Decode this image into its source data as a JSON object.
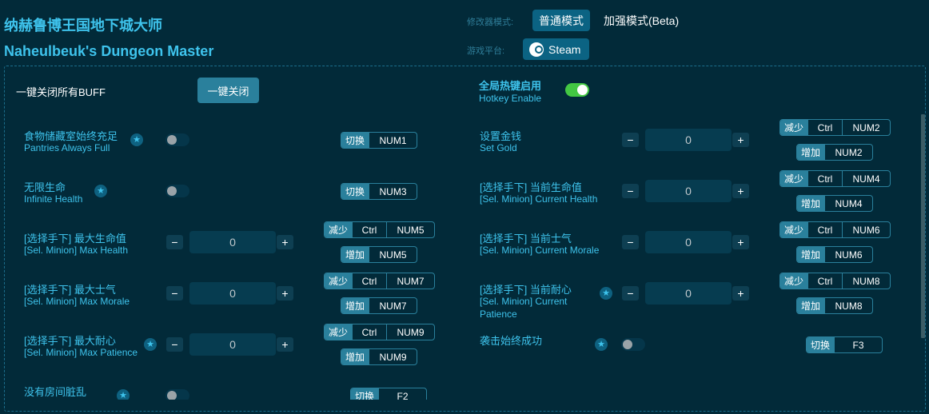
{
  "header": {
    "title_cn": "纳赫鲁博王国地下城大师",
    "title_en": "Naheulbeuk's Dungeon Master",
    "mode_label": "修改器模式:",
    "mode_normal": "普通模式",
    "mode_beta": "加强模式(Beta)",
    "platform_label": "游戏平台:",
    "platform": "Steam"
  },
  "global": {
    "close_all_label": "一键关闭所有BUFF",
    "close_all_button": "一键关闭",
    "hotkey_cn": "全局热键启用",
    "hotkey_en": "Hotkey Enable",
    "hotkey_enabled": true
  },
  "tags": {
    "toggle": "切换",
    "decrease": "减少",
    "increase": "增加",
    "ctrl": "Ctrl"
  },
  "left": [
    {
      "cn": "食物储藏室始终充足",
      "en": "Pantries Always Full",
      "type": "toggle",
      "on": false,
      "key": "NUM1"
    },
    {
      "cn": "无限生命",
      "en": "Infinite Health",
      "type": "toggle",
      "on": false,
      "key": "NUM3"
    },
    {
      "cn": "[选择手下] 最大生命值",
      "en": "[Sel. Minion] Max Health",
      "type": "number",
      "value": "0",
      "dec_key": "NUM5",
      "inc_key": "NUM5"
    },
    {
      "cn": "[选择手下] 最大士气",
      "en": "[Sel. Minion] Max Morale",
      "type": "number",
      "value": "0",
      "dec_key": "NUM7",
      "inc_key": "NUM7"
    },
    {
      "cn": "[选择手下] 最大耐心",
      "en": "[Sel. Minion] Max Patience",
      "type": "number",
      "value": "0",
      "dec_key": "NUM9",
      "inc_key": "NUM9"
    },
    {
      "cn": "没有房间脏乱",
      "en": "",
      "type": "toggle",
      "on": false,
      "key": "F2"
    }
  ],
  "right": [
    {
      "cn": "设置金钱",
      "en": "Set Gold",
      "type": "number",
      "value": "0",
      "dec_key": "NUM2",
      "inc_key": "NUM2"
    },
    {
      "cn": "[选择手下] 当前生命值",
      "en": "[Sel. Minion] Current Health",
      "type": "number",
      "value": "0",
      "dec_key": "NUM4",
      "inc_key": "NUM4"
    },
    {
      "cn": "[选择手下] 当前士气",
      "en": "[Sel. Minion] Current Morale",
      "type": "number",
      "value": "0",
      "dec_key": "NUM6",
      "inc_key": "NUM6"
    },
    {
      "cn": "[选择手下] 当前耐心",
      "en": "[Sel. Minion] Current Patience",
      "type": "number",
      "value": "0",
      "dec_key": "NUM8",
      "inc_key": "NUM8"
    },
    {
      "cn": "袭击始终成功",
      "en": "",
      "type": "toggle",
      "on": false,
      "key": "F3"
    }
  ],
  "icons": {
    "star": "★",
    "minus": "−",
    "plus": "+"
  }
}
